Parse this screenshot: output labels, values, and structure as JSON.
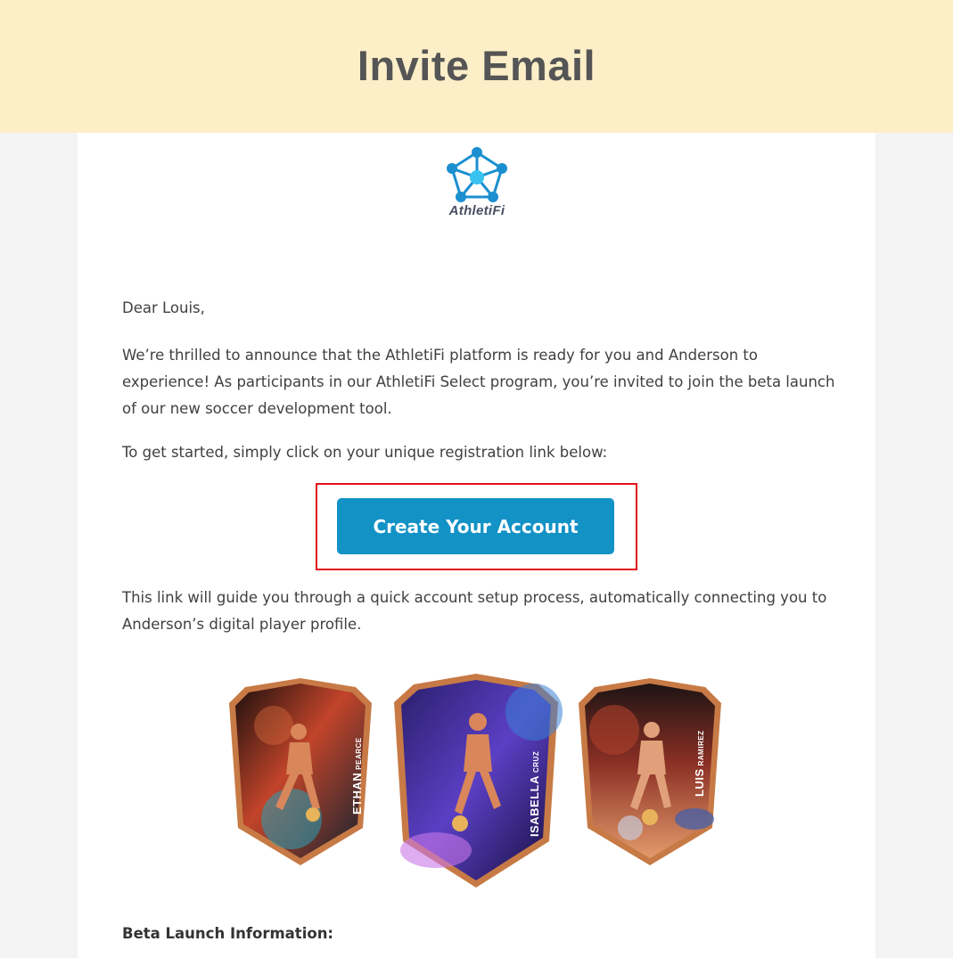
{
  "banner": {
    "title": "Invite Email"
  },
  "logo": {
    "brand_name": "AthletiFi"
  },
  "email": {
    "greeting": "Dear Louis,",
    "paragraph_1": "We’re thrilled to announce that the AthletiFi platform is ready for you and Anderson to experience! As participants in our AthletiFi Select program, you’re invited to join the beta launch of our new soccer development tool.",
    "paragraph_2": "To get started, simply click on your unique registration link below:",
    "cta_label": "Create Your Account",
    "paragraph_3": "This link will guide you through a quick account setup process, automatically connecting you to Anderson’s digital player profile.",
    "cards": [
      {
        "first_name": "ETHAN",
        "last_name": "PEARCE",
        "theme_colors": [
          "#1a0f0d",
          "#c2442a",
          "#2aa0b5"
        ]
      },
      {
        "first_name": "ISABELLA",
        "last_name": "CRUZ",
        "theme_colors": [
          "#1b1450",
          "#5b3fc4",
          "#c877e8"
        ]
      },
      {
        "first_name": "LUIS",
        "last_name": "RAMIREZ",
        "theme_colors": [
          "#1d1414",
          "#b0412c",
          "#e39a6b"
        ]
      }
    ],
    "section_heading": "Beta Launch Information:"
  },
  "colors": {
    "banner_bg": "#fcefc8",
    "cta_bg": "#1392c6",
    "highlight_border": "#e0101b",
    "card_frame": "#c77a45"
  }
}
